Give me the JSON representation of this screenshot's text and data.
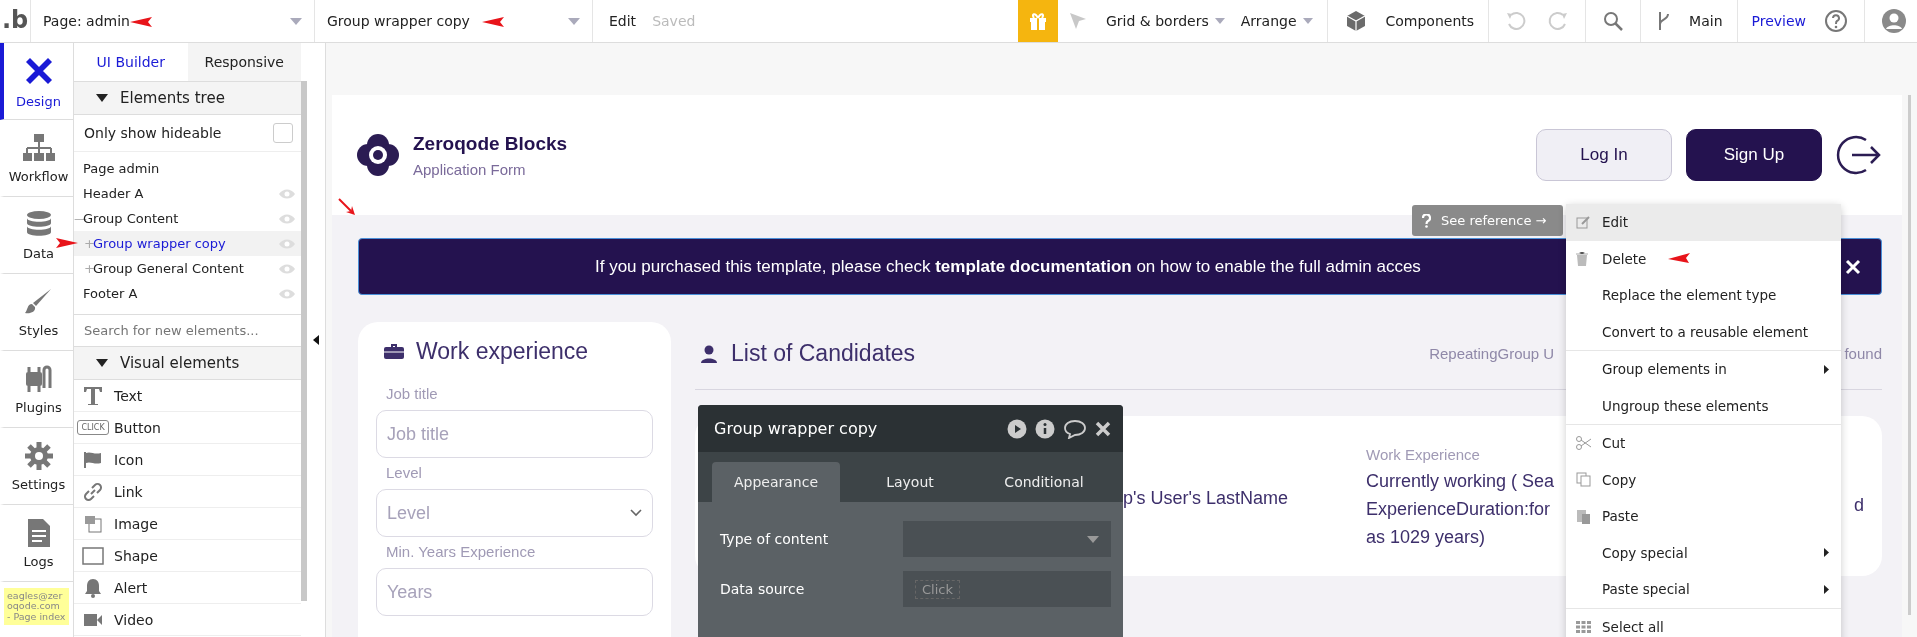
{
  "topbar": {
    "logo": ".b",
    "page_selector": "Page: admin",
    "element_selector": "Group wrapper copy",
    "edit": "Edit",
    "status": "Saved",
    "grid": "Grid & borders",
    "arrange": "Arrange",
    "components": "Components",
    "branch": "Main",
    "preview": "Preview"
  },
  "nav": [
    {
      "label": "Design",
      "kind": "design",
      "selected": true
    },
    {
      "label": "Workflow",
      "kind": "workflow",
      "selected": false
    },
    {
      "label": "Data",
      "kind": "data",
      "selected": false
    },
    {
      "label": "Styles",
      "kind": "styles",
      "selected": false
    },
    {
      "label": "Plugins",
      "kind": "plugins",
      "selected": false
    },
    {
      "label": "Settings",
      "kind": "settings",
      "selected": false
    },
    {
      "label": "Logs",
      "kind": "logs",
      "selected": false
    }
  ],
  "user_note": "eagles@zeroqode.com - Page index",
  "panel_tabs": [
    {
      "label": "UI Builder",
      "selected": true
    },
    {
      "label": "Responsive",
      "selected": false
    }
  ],
  "elements_tree": {
    "title": "Elements tree",
    "filter_label": "Only show hideable",
    "filter_checked": false,
    "items": [
      {
        "label": "Page admin",
        "eye": false,
        "selected": false
      },
      {
        "label": "Header A",
        "eye": true,
        "selected": false
      },
      {
        "label": "Group Content",
        "toggle": "—",
        "eye": true,
        "selected": false,
        "children": [
          {
            "label": "Group wrapper copy",
            "toggle": "+",
            "eye": true,
            "selected": true
          },
          {
            "label": "Group General Content",
            "toggle": "+",
            "eye": true,
            "selected": false
          }
        ]
      },
      {
        "label": "Footer A",
        "eye": true,
        "selected": false
      }
    ]
  },
  "element_search": {
    "placeholder": "Search for new elements..."
  },
  "visual_elements": {
    "title": "Visual elements",
    "items": [
      {
        "label": "Text",
        "kind": "text"
      },
      {
        "label": "Button",
        "kind": "button",
        "badge": "CLICK"
      },
      {
        "label": "Icon",
        "kind": "icon"
      },
      {
        "label": "Link",
        "kind": "link"
      },
      {
        "label": "Image",
        "kind": "image"
      },
      {
        "label": "Shape",
        "kind": "shape"
      },
      {
        "label": "Alert",
        "kind": "alert"
      },
      {
        "label": "Video",
        "kind": "video"
      }
    ]
  },
  "canvas": {
    "brand": "Zeroqode Blocks",
    "subtitle": "Application Form",
    "buttons": [
      {
        "label": "Log In",
        "kind": "secondary"
      },
      {
        "label": "Sign Up",
        "kind": "primary"
      }
    ],
    "banner": "If you purchased this template, please check **template documentation** on how to enable the full admin acces",
    "work_card": {
      "title": "Work experience",
      "fields": [
        {
          "label": "Job title",
          "placeholder": "Job title",
          "kind": "text"
        },
        {
          "label": "Level",
          "placeholder": "Level",
          "kind": "select"
        },
        {
          "label": "Min. Years Experience",
          "placeholder": "Years",
          "kind": "text"
        }
      ]
    },
    "list_title": "List of Candidates",
    "list_note_left": "RepeatingGroup U",
    "list_note_right": "found",
    "candidate": {
      "name": "p's User's LastName",
      "work_label": "Work Experience",
      "work_lines": [
        "Currently working ( Sea",
        "ExperienceDuration:for",
        "as 1029 years)"
      ],
      "column_3": "d"
    }
  },
  "see_reference": "See reference →",
  "property_panel": {
    "title": "Group wrapper copy",
    "tabs": [
      {
        "label": "Appearance",
        "selected": true
      },
      {
        "label": "Layout",
        "selected": false
      },
      {
        "label": "Conditional",
        "selected": false
      }
    ],
    "rows": [
      {
        "label": "Type of content",
        "kind": "dropdown"
      },
      {
        "label": "Data source",
        "kind": "click",
        "value": "Click"
      }
    ]
  },
  "context_menu": [
    [
      {
        "label": "Edit",
        "kind": "edit",
        "submenu": false,
        "highlighted": true
      },
      {
        "label": "Delete",
        "kind": "delete",
        "submenu": false,
        "highlighted": false
      },
      {
        "label": "Replace the element type",
        "kind": "plain",
        "submenu": false,
        "highlighted": false
      },
      {
        "label": "Convert to a reusable element",
        "kind": "plain",
        "submenu": false,
        "highlighted": false
      }
    ],
    [
      {
        "label": "Group elements in",
        "kind": "plain",
        "submenu": true,
        "highlighted": false
      },
      {
        "label": "Ungroup these elements",
        "kind": "plain",
        "submenu": false,
        "highlighted": false
      }
    ],
    [
      {
        "label": "Cut",
        "kind": "cut",
        "submenu": false,
        "highlighted": false
      },
      {
        "label": "Copy",
        "kind": "copy",
        "submenu": false,
        "highlighted": false
      },
      {
        "label": "Paste",
        "kind": "paste",
        "submenu": false,
        "highlighted": false
      },
      {
        "label": "Copy special",
        "kind": "plain",
        "submenu": true,
        "highlighted": false
      },
      {
        "label": "Paste special",
        "kind": "plain",
        "submenu": true,
        "highlighted": false
      }
    ],
    [
      {
        "label": "Select all",
        "kind": "select",
        "submenu": false,
        "highlighted": false
      }
    ]
  ]
}
